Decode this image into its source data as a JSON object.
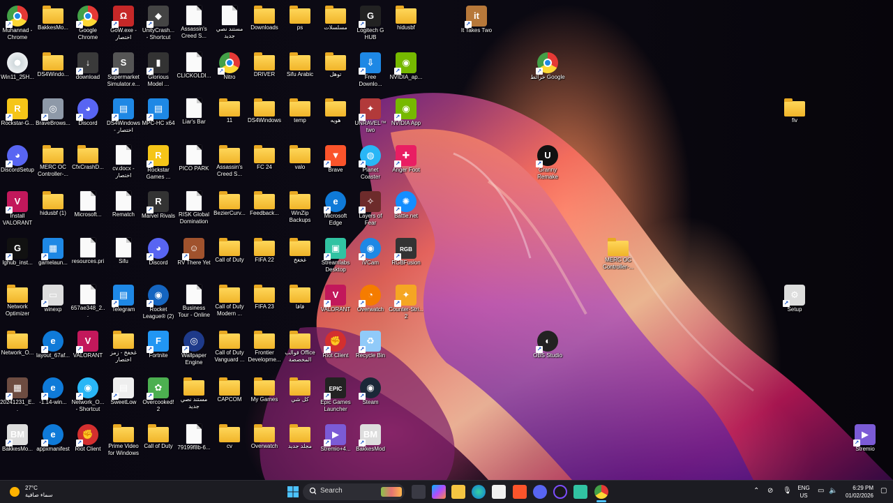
{
  "desktop": {
    "icons": [
      {
        "label": "Muhannad - Chrome",
        "kind": "chrome",
        "color": "#e84c3d"
      },
      {
        "label": "BakkesMo...",
        "kind": "folder"
      },
      {
        "label": "Google Chrome",
        "kind": "chrome",
        "color": "#4caf50"
      },
      {
        "label": "GoW.exe - اختصار",
        "kind": "app",
        "color": "#c62828",
        "glyph": "Ω"
      },
      {
        "label": "UnityCrash... - Shortcut",
        "kind": "app",
        "color": "#444",
        "glyph": "◆"
      },
      {
        "label": "Assassin's Creed S...",
        "kind": "file"
      },
      {
        "label": "مستند نصي جديد",
        "kind": "file"
      },
      {
        "label": "Downloads",
        "kind": "folder"
      },
      {
        "label": "ps",
        "kind": "folder"
      },
      {
        "label": "مسلسلات",
        "kind": "folder"
      },
      {
        "label": "Logitech G HUB",
        "kind": "app",
        "color": "#222",
        "glyph": "G"
      },
      {
        "label": "hidusbf",
        "kind": "folder"
      },
      {
        "label": "It Takes Two",
        "kind": "app",
        "color": "#b7783a",
        "glyph": "it"
      },
      {
        "label": "Win11_25H...",
        "kind": "disc"
      },
      {
        "label": "DS4Windo...",
        "kind": "folder"
      },
      {
        "label": "download",
        "kind": "app",
        "color": "#3a3a3a",
        "glyph": "↓"
      },
      {
        "label": "Supermarket Simulator.e...",
        "kind": "app",
        "color": "#555",
        "glyph": "S"
      },
      {
        "label": "Glorious Model ...",
        "kind": "app",
        "color": "#333",
        "glyph": "▮"
      },
      {
        "label": "CLICKOLDI...",
        "kind": "file"
      },
      {
        "label": "Nitro",
        "kind": "chrome",
        "color": "#1e88e5"
      },
      {
        "label": "DRIVER",
        "kind": "folder"
      },
      {
        "label": "Sifu Arabic",
        "kind": "folder"
      },
      {
        "label": "توهل",
        "kind": "folder"
      },
      {
        "label": "Free Downlo...",
        "kind": "app",
        "color": "#1e88e5",
        "glyph": "⇩"
      },
      {
        "label": "NVIDIA_ap...",
        "kind": "app",
        "color": "#76b900",
        "glyph": "◉"
      },
      {
        "label": "خرائط Google",
        "kind": "chrome",
        "color": "#43a047"
      },
      {
        "label": "Rockstar-G...",
        "kind": "app",
        "color": "#f5c518",
        "glyph": "R"
      },
      {
        "label": "BraveBrows...",
        "kind": "app",
        "color": "#8e99a8",
        "glyph": "◎"
      },
      {
        "label": "Discord",
        "kind": "app",
        "color": "#5865f2",
        "glyph": "◕",
        "round": true
      },
      {
        "label": "DS4Windows - اختصار",
        "kind": "app",
        "color": "#1e88e5",
        "glyph": "▤"
      },
      {
        "label": "MPC-HC x64",
        "kind": "app",
        "color": "#1e88e5",
        "glyph": "▤"
      },
      {
        "label": "Liar's Bar",
        "kind": "file"
      },
      {
        "label": "11",
        "kind": "folder"
      },
      {
        "label": "DS4Windows",
        "kind": "folder"
      },
      {
        "label": "temp",
        "kind": "folder"
      },
      {
        "label": "هويه",
        "kind": "folder"
      },
      {
        "label": "UNRAVEL™ two",
        "kind": "app",
        "color": "#b23a3a",
        "glyph": "✦"
      },
      {
        "label": "NVIDIA App",
        "kind": "app",
        "color": "#76b900",
        "glyph": "◉"
      },
      {
        "label": "fiv",
        "kind": "folder"
      },
      {
        "label": "DiscordSetup",
        "kind": "app",
        "color": "#5865f2",
        "glyph": "◕",
        "round": true
      },
      {
        "label": "MERC OC Controller-...",
        "kind": "folder"
      },
      {
        "label": "CfxCrashD...",
        "kind": "folder"
      },
      {
        "label": "cv.docx - اختصار",
        "kind": "file"
      },
      {
        "label": "Rockstar Games ...",
        "kind": "app",
        "color": "#f5c518",
        "glyph": "R"
      },
      {
        "label": "PICO PARK",
        "kind": "file"
      },
      {
        "label": "Assassin's Creed S...",
        "kind": "folder"
      },
      {
        "label": "FC 24",
        "kind": "folder"
      },
      {
        "label": "valo",
        "kind": "folder"
      },
      {
        "label": "Brave",
        "kind": "app",
        "color": "#fb542b",
        "glyph": "▼"
      },
      {
        "label": "Planet Coaster",
        "kind": "app",
        "color": "#29b6f6",
        "glyph": "◍",
        "round": true
      },
      {
        "label": "Anger Foot",
        "kind": "app",
        "color": "#e91e63",
        "glyph": "✚"
      },
      {
        "label": "Granny Remake",
        "kind": "app",
        "color": "#111",
        "glyph": "U",
        "round": true
      },
      {
        "label": "Install VALORANT",
        "kind": "app",
        "color": "#c2185b",
        "glyph": "V"
      },
      {
        "label": "hidusbf (1)",
        "kind": "folder"
      },
      {
        "label": "Microsoft...",
        "kind": "file"
      },
      {
        "label": "Rematch",
        "kind": "file"
      },
      {
        "label": "Marvel Rivals",
        "kind": "app",
        "color": "#333",
        "glyph": "R"
      },
      {
        "label": "RISK Global Domination",
        "kind": "file"
      },
      {
        "label": "BezierCurv...",
        "kind": "folder"
      },
      {
        "label": "Feedback...",
        "kind": "folder"
      },
      {
        "label": "WinZip Backups",
        "kind": "folder"
      },
      {
        "label": "Microsoft Edge",
        "kind": "app",
        "color": "#0f7ad8",
        "glyph": "e",
        "round": true
      },
      {
        "label": "Layers of Fear",
        "kind": "app",
        "color": "#6d2b2b",
        "glyph": "✧"
      },
      {
        "label": "Battle.net",
        "kind": "app",
        "color": "#148eff",
        "glyph": "✺",
        "round": true
      },
      {
        "label": "Ighub_inst...",
        "kind": "app",
        "color": "#111",
        "glyph": "G"
      },
      {
        "label": "gamelaun...",
        "kind": "app",
        "color": "#1e88e5",
        "glyph": "▦"
      },
      {
        "label": "resources.pri",
        "kind": "file"
      },
      {
        "label": "Sifu",
        "kind": "file"
      },
      {
        "label": "Discord",
        "kind": "app",
        "color": "#5865f2",
        "glyph": "◕",
        "round": true
      },
      {
        "label": "RV There Yet",
        "kind": "app",
        "color": "#a0522d",
        "glyph": "☺"
      },
      {
        "label": "Call of Duty",
        "kind": "folder"
      },
      {
        "label": "FIFA 22",
        "kind": "folder"
      },
      {
        "label": "غخغخ",
        "kind": "folder"
      },
      {
        "label": "Streamlabs Desktop",
        "kind": "app",
        "color": "#31c3a2",
        "glyph": "▣"
      },
      {
        "label": "iVCam",
        "kind": "app",
        "color": "#1e88e5",
        "glyph": "◉",
        "round": true
      },
      {
        "label": "RGBFusion",
        "kind": "app",
        "color": "#333",
        "glyph": "RGB"
      },
      {
        "label": "MERC OC Controller-...",
        "kind": "folder"
      },
      {
        "label": "Network Optimizer",
        "kind": "folder"
      },
      {
        "label": "winexp",
        "kind": "app",
        "color": "#ddd",
        "glyph": "▭"
      },
      {
        "label": "657ae348_2...",
        "kind": "file"
      },
      {
        "label": "Telegram",
        "kind": "app",
        "color": "#1e88e5",
        "glyph": "▤"
      },
      {
        "label": "Rocket League® (2)",
        "kind": "app",
        "color": "#1565c0",
        "glyph": "◉",
        "round": true
      },
      {
        "label": "Business Tour - Online M...",
        "kind": "file"
      },
      {
        "label": "Call of Duty Modern ...",
        "kind": "folder"
      },
      {
        "label": "FIFA 23",
        "kind": "folder"
      },
      {
        "label": "قاقا",
        "kind": "folder"
      },
      {
        "label": "VALORANT",
        "kind": "app",
        "color": "#c2185b",
        "glyph": "V"
      },
      {
        "label": "Overwatch",
        "kind": "app",
        "color": "#f57c00",
        "glyph": "◔",
        "round": true
      },
      {
        "label": "Counter-Stri... 2",
        "kind": "app",
        "color": "#f5a623",
        "glyph": "✦"
      },
      {
        "label": "Setup",
        "kind": "app",
        "color": "#ddd",
        "glyph": "⚙"
      },
      {
        "label": "Network_O...",
        "kind": "folder"
      },
      {
        "label": "layout_67af...",
        "kind": "app",
        "color": "#0f7ad8",
        "glyph": "e",
        "round": true
      },
      {
        "label": "VALORANT",
        "kind": "app",
        "color": "#c2185b",
        "glyph": "V"
      },
      {
        "label": "غخغخ - زمز اختصار",
        "kind": "folder"
      },
      {
        "label": "Fortnite",
        "kind": "app",
        "color": "#2196f3",
        "glyph": "F"
      },
      {
        "label": "Wallpaper Engine",
        "kind": "app",
        "color": "#1e3a8a",
        "glyph": "◎",
        "round": true
      },
      {
        "label": "Call of Duty Vanguard ...",
        "kind": "folder"
      },
      {
        "label": "Frontier Developme...",
        "kind": "folder"
      },
      {
        "label": "قوالب Office المخصصة",
        "kind": "folder"
      },
      {
        "label": "Riot Client",
        "kind": "app",
        "color": "#d32f2f",
        "glyph": "✊",
        "round": true
      },
      {
        "label": "Recycle Bin",
        "kind": "app",
        "color": "#90caf9",
        "glyph": "♻"
      },
      {
        "label": "OBS Studio",
        "kind": "app",
        "color": "#222",
        "glyph": "◐",
        "round": true
      },
      {
        "label": "20241231_E...",
        "kind": "app",
        "color": "#6d4c41",
        "glyph": "▦"
      },
      {
        "label": "-1.14-win...",
        "kind": "app",
        "color": "#0f7ad8",
        "glyph": "e",
        "round": true
      },
      {
        "label": "Network_O... - Shortcut",
        "kind": "app",
        "color": "#29b6f6",
        "glyph": "◉",
        "round": true
      },
      {
        "label": "SweetLow",
        "kind": "app",
        "color": "#eee",
        "glyph": "▤"
      },
      {
        "label": "Overcooked! 2",
        "kind": "app",
        "color": "#4caf50",
        "glyph": "✿"
      },
      {
        "label": "مستند نصي جديد",
        "kind": "folder"
      },
      {
        "label": "CAPCOM",
        "kind": "folder"
      },
      {
        "label": "My Games",
        "kind": "folder"
      },
      {
        "label": "كل شي",
        "kind": "folder"
      },
      {
        "label": "Epic Games Launcher",
        "kind": "app",
        "color": "#222",
        "glyph": "EPIC"
      },
      {
        "label": "Steam",
        "kind": "app",
        "color": "#1b2838",
        "glyph": "◉",
        "round": true
      },
      {
        "label": "BakkesMo...",
        "kind": "app",
        "color": "#ddd",
        "glyph": "BM"
      },
      {
        "label": "appxmanifest",
        "kind": "app",
        "color": "#0f7ad8",
        "glyph": "e",
        "round": true
      },
      {
        "label": "Riot Client",
        "kind": "app",
        "color": "#d32f2f",
        "glyph": "✊",
        "round": true
      },
      {
        "label": "Prime Video for Windows",
        "kind": "folder"
      },
      {
        "label": "Call of Duty",
        "kind": "folder"
      },
      {
        "label": "79199f8b-6...",
        "kind": "file"
      },
      {
        "label": "cv",
        "kind": "folder"
      },
      {
        "label": "Overwatch",
        "kind": "folder"
      },
      {
        "label": "مجلد جديد",
        "kind": "folder"
      },
      {
        "label": "Stremio+4...",
        "kind": "app",
        "color": "#7b5bd6",
        "glyph": "▶"
      },
      {
        "label": "BakkesMod",
        "kind": "app",
        "color": "#ddd",
        "glyph": "BM"
      },
      {
        "label": "Stremio",
        "kind": "app",
        "color": "#7b5bd6",
        "glyph": "▶"
      }
    ]
  },
  "taskbar": {
    "weather": {
      "temp": "27°C",
      "desc": "سماء صافية"
    },
    "search_placeholder": "Search",
    "language": {
      "line1": "ENG",
      "line2": "US"
    },
    "time": "6:29 PM",
    "date": "01/02/2026"
  }
}
